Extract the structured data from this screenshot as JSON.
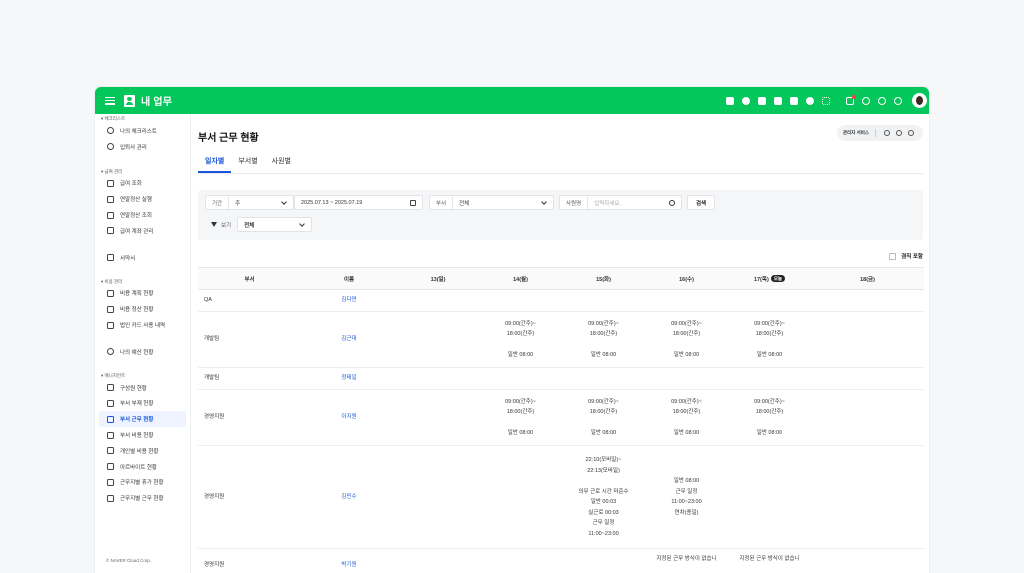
{
  "topbar": {
    "title": "내 업무",
    "icons": [
      "apps-icon",
      "chat-icon",
      "mail-icon",
      "calendar-icon",
      "note-icon",
      "drive-icon",
      "grid-icon",
      "bell-icon",
      "org-icon",
      "help-icon",
      "settings-icon"
    ]
  },
  "sidebar": {
    "sections": [
      {
        "title": "▾ 체크리스트",
        "items": [
          "나의 체크리스트",
          "입퇴사 관리"
        ]
      },
      {
        "title": "▾ 급여 관리",
        "items": [
          "급여 조회",
          "연말정산 실행",
          "연말정산 조회",
          "급여 계좌 관리",
          "",
          "서약서"
        ]
      },
      {
        "title": "▾ 비용 관리",
        "items": [
          "비용 계획 현황",
          "비용 정산 현황",
          "법인 카드 사용 내역",
          "",
          "나의 예산 현황"
        ]
      },
      {
        "title": "▾ 매니지먼트",
        "items": [
          "구성원 현황",
          "부서 부재 현황",
          "부서 근무 현황",
          "부서 비용 현황",
          "개인별 비용 현황",
          "아르바이트 현황",
          "근무지별 휴가 현황",
          "근무지별 근무 현황"
        ]
      }
    ],
    "active": "부서 근무 현황",
    "footer": "© NAVER Cloud Corp."
  },
  "page": {
    "title": "부서 근무 현황",
    "manager_service": "관리자 서비스",
    "tabs": [
      "일자별",
      "부서별",
      "사원별"
    ],
    "active_tab": "일자별"
  },
  "filters": {
    "period_label": "기간",
    "period_value": "주",
    "date_range": "2025.07.13 ~ 2025.07.19",
    "dept_label": "부서",
    "dept_value": "전체",
    "employee_label": "사원명",
    "employee_placeholder": "입력하세요.",
    "search_button": "검색",
    "view_label": "보기",
    "view_value": "전체"
  },
  "retire_toggle": "겸직 포함",
  "table": {
    "columns": [
      "부서",
      "이름",
      "13(일)",
      "14(월)",
      "15(화)",
      "16(수)",
      "17(목)",
      "18(금)"
    ],
    "today_badge": "오늘",
    "rows": [
      {
        "dept": "QA",
        "name": "김다연",
        "cells": [
          "",
          "",
          "",
          "",
          "",
          ""
        ]
      },
      {
        "dept": "개발팀",
        "name": "김근대",
        "cells": [
          "",
          "09:00(간주)~\n18:00(간주)\n\n일반 08:00",
          "09:00(간주)~\n18:00(간주)\n\n일반 08:00",
          "09:00(간주)~\n18:00(간주)\n\n일반 08:00",
          "09:00(간주)~\n18:00(간주)\n\n일반 08:00",
          ""
        ]
      },
      {
        "dept": "개발팀",
        "name": "정태일",
        "cells": [
          "",
          "",
          "",
          "",
          "",
          ""
        ]
      },
      {
        "dept": "경영지원",
        "name": "이지원",
        "cells": [
          "",
          "09:00(간주)~\n18:00(간주)\n\n일반 08:00",
          "09:00(간주)~\n18:00(간주)\n\n일반 08:00",
          "09:00(간주)~\n18:00(간주)\n\n일반 08:00",
          "09:00(간주)~\n18:00(간주)\n\n일반 08:00",
          ""
        ]
      },
      {
        "dept": "경영지원",
        "name": "김민수",
        "cells": [
          "",
          "",
          "22:10(모바일)~\n22:13(모바일)\n\n의무 근로 시간 미준수\n일반 00:03\n실근로 00:03\n근무 일정\n11:00~23:00",
          "일반 08:00\n근무 일정\n11:00~23:00\n연차(종일)",
          "",
          ""
        ]
      },
      {
        "dept": "경영지원",
        "name": "박기원",
        "cells": [
          "",
          "",
          "",
          "지정된 근무 방식이 없습니",
          "지정된 근무 방식이 없습니",
          ""
        ]
      }
    ]
  }
}
